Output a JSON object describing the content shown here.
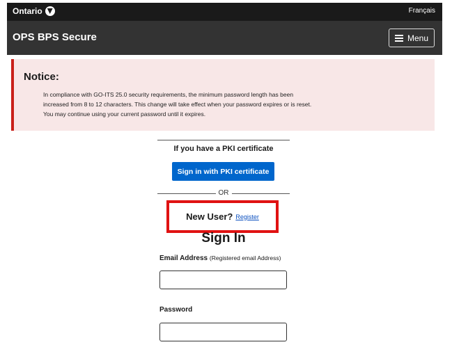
{
  "topbar": {
    "brand": "Ontario",
    "language": "Français"
  },
  "header": {
    "title": "OPS BPS Secure",
    "menu_label": "Menu"
  },
  "notice": {
    "title": "Notice:",
    "lines": [
      "In compliance with GO-ITS 25.0 security requirements, the minimum password length has been",
      "increased from 8 to 12 characters. This change will take effect when your password expires or is reset.",
      "You may continue using your current password until it expires."
    ]
  },
  "pki": {
    "heading": "If you have a PKI certificate",
    "button_label": "Sign in with PKI certificate",
    "or_label": "OR"
  },
  "new_user": {
    "label": "New User?",
    "register_link": "Register"
  },
  "signin": {
    "title": "Sign In",
    "email_label": "Email Address",
    "email_hint": "(Registered email Address)",
    "email_value": "",
    "password_label": "Password",
    "password_value": ""
  },
  "colors": {
    "notice_accent": "#c9201a",
    "primary_button": "#0066cc",
    "highlight_box": "#e01212"
  }
}
